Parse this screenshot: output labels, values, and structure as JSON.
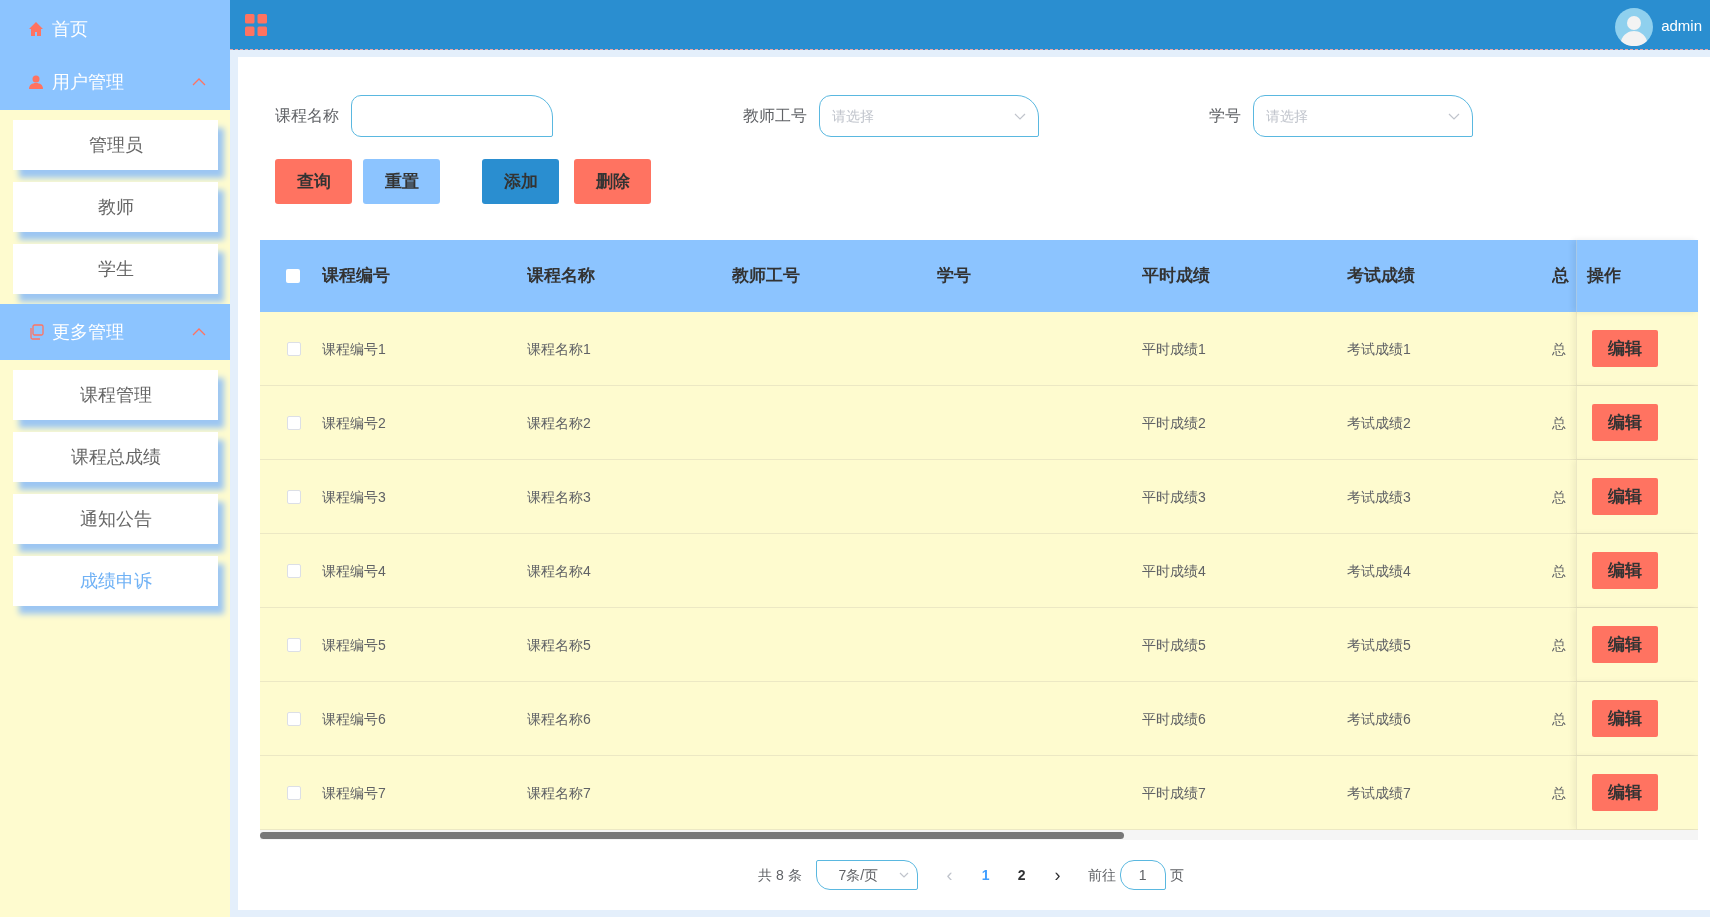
{
  "sidebar": {
    "items": [
      {
        "label": "首页",
        "kind": "link"
      },
      {
        "label": "用户管理",
        "kind": "group",
        "expanded": true,
        "children": [
          {
            "label": "管理员",
            "selected": false
          },
          {
            "label": "教师",
            "selected": false
          },
          {
            "label": "学生",
            "selected": false
          }
        ]
      },
      {
        "label": "更多管理",
        "kind": "group",
        "expanded": true,
        "children": [
          {
            "label": "课程管理",
            "selected": false
          },
          {
            "label": "课程总成绩",
            "selected": false
          },
          {
            "label": "通知公告",
            "selected": false
          },
          {
            "label": "成绩申诉",
            "selected": true
          }
        ]
      }
    ]
  },
  "topbar": {
    "user": "admin"
  },
  "filters": [
    {
      "kind": "input",
      "label": "课程名称"
    },
    {
      "kind": "select",
      "label": "教师工号",
      "placeholder": "请选择"
    },
    {
      "kind": "select",
      "label": "学号",
      "placeholder": "请选择"
    }
  ],
  "buttons": [
    {
      "label": "查询",
      "color": "#ff7361"
    },
    {
      "label": "重置",
      "color": "#8cc4ff"
    },
    {
      "label": "添加",
      "color": "#2a8ed0"
    },
    {
      "label": "删除",
      "color": "#ff7361"
    }
  ],
  "table": {
    "select_all_checked": false,
    "columns": [
      "课程编号",
      "课程名称",
      "教师工号",
      "学号",
      "平时成绩",
      "考试成绩",
      "总",
      "操作"
    ],
    "rows": [
      {
        "checked": false,
        "cells": [
          "课程编号1",
          "课程名称1",
          "",
          "",
          "平时成绩1",
          "考试成绩1",
          "总"
        ],
        "action": "编辑"
      },
      {
        "checked": false,
        "cells": [
          "课程编号2",
          "课程名称2",
          "",
          "",
          "平时成绩2",
          "考试成绩2",
          "总"
        ],
        "action": "编辑"
      },
      {
        "checked": false,
        "cells": [
          "课程编号3",
          "课程名称3",
          "",
          "",
          "平时成绩3",
          "考试成绩3",
          "总"
        ],
        "action": "编辑"
      },
      {
        "checked": false,
        "cells": [
          "课程编号4",
          "课程名称4",
          "",
          "",
          "平时成绩4",
          "考试成绩4",
          "总"
        ],
        "action": "编辑"
      },
      {
        "checked": false,
        "cells": [
          "课程编号5",
          "课程名称5",
          "",
          "",
          "平时成绩5",
          "考试成绩5",
          "总"
        ],
        "action": "编辑"
      },
      {
        "checked": false,
        "cells": [
          "课程编号6",
          "课程名称6",
          "",
          "",
          "平时成绩6",
          "考试成绩6",
          "总"
        ],
        "action": "编辑"
      },
      {
        "checked": false,
        "cells": [
          "课程编号7",
          "课程名称7",
          "",
          "",
          "平时成绩7",
          "考试成绩7",
          "总"
        ],
        "action": "编辑"
      }
    ]
  },
  "pagination": {
    "total": "共 8 条",
    "page_size": "7条/页",
    "prev": "‹",
    "pages": [
      {
        "label": "1",
        "selected": true
      },
      {
        "label": "2",
        "selected": false
      }
    ],
    "next": "›",
    "goto_label": "前往",
    "goto_value": "1",
    "goto_suffix": "页"
  }
}
